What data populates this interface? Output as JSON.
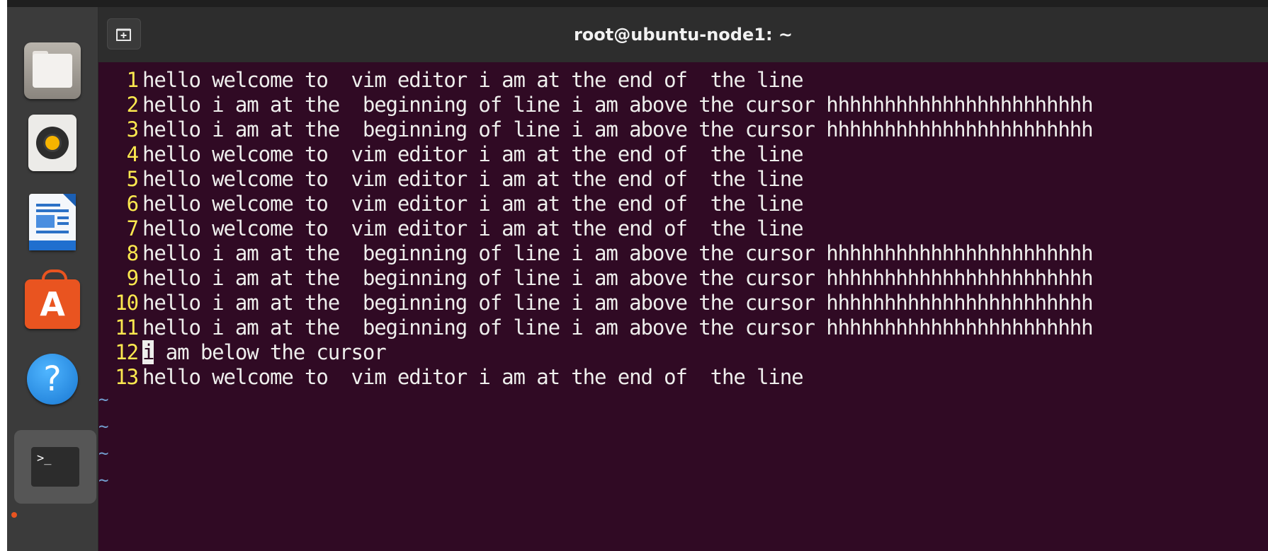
{
  "window": {
    "title": "root@ubuntu-node1: ~"
  },
  "dock": {
    "items": [
      {
        "name": "files",
        "icon": "files-icon"
      },
      {
        "name": "rhythmbox",
        "icon": "speaker-icon"
      },
      {
        "name": "libreoffice-writer",
        "icon": "document-icon"
      },
      {
        "name": "ubuntu-software",
        "icon": "shopping-bag-icon",
        "glyph": "A"
      },
      {
        "name": "help",
        "icon": "help-icon",
        "glyph": "?"
      },
      {
        "name": "terminal",
        "icon": "terminal-icon",
        "glyph": ">_",
        "active": true
      }
    ],
    "accent_color": "#e95420"
  },
  "editor": {
    "lines": [
      {
        "num": "1",
        "text": "hello welcome to  vim editor i am at the end of  the line"
      },
      {
        "num": "2",
        "text": "hello i am at the  beginning of line i am above the cursor hhhhhhhhhhhhhhhhhhhhhhh"
      },
      {
        "num": "3",
        "text": "hello i am at the  beginning of line i am above the cursor hhhhhhhhhhhhhhhhhhhhhhh"
      },
      {
        "num": "4",
        "text": "hello welcome to  vim editor i am at the end of  the line"
      },
      {
        "num": "5",
        "text": "hello welcome to  vim editor i am at the end of  the line"
      },
      {
        "num": "6",
        "text": "hello welcome to  vim editor i am at the end of  the line"
      },
      {
        "num": "7",
        "text": "hello welcome to  vim editor i am at the end of  the line"
      },
      {
        "num": "8",
        "text": "hello i am at the  beginning of line i am above the cursor hhhhhhhhhhhhhhhhhhhhhhh"
      },
      {
        "num": "9",
        "text": "hello i am at the  beginning of line i am above the cursor hhhhhhhhhhhhhhhhhhhhhhh"
      },
      {
        "num": "10",
        "text": "hello i am at the  beginning of line i am above the cursor hhhhhhhhhhhhhhhhhhhhhhh"
      },
      {
        "num": "11",
        "text": "hello i am at the  beginning of line i am above the cursor hhhhhhhhhhhhhhhhhhhhhhh"
      },
      {
        "num": "12",
        "cursor_char": "i",
        "text": " am below the cursor"
      },
      {
        "num": "13",
        "text": "hello welcome to  vim editor i am at the end of  the line"
      }
    ],
    "empty_markers": [
      "~",
      "~",
      "~",
      "~"
    ],
    "colors": {
      "background": "#300a24",
      "line_number": "#fce94f",
      "text": "#eeeeec",
      "tilde": "#729fcf"
    }
  }
}
